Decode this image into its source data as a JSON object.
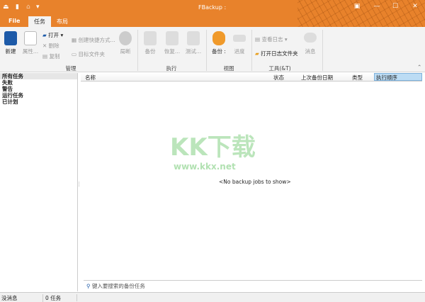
{
  "window": {
    "title": "FBackup :",
    "restore_icon": "restore-icon",
    "minimize": "—",
    "maximize": "☐",
    "close": "✕"
  },
  "tabs": [
    "File",
    "任务",
    "布局"
  ],
  "ribbon": {
    "manage": {
      "label": "管理",
      "new": "新建",
      "props": "属性...",
      "open": "打开",
      "delete": "删除",
      "copy": "复制",
      "create_shortcut": "创建快捷方式...",
      "target_folder": "目标文件夹",
      "restore": "局断"
    },
    "run": {
      "label": "执行",
      "backup": "备份",
      "restore": "恢复...",
      "test": "测试..."
    },
    "view": {
      "label": "视图",
      "backup": "备份 :",
      "progress": "进度"
    },
    "tools": {
      "label": "工具(&T)",
      "view_log": "查看日志",
      "open_log_folder": "打开日志文件夹",
      "message": "消息"
    }
  },
  "sidebar": [
    "所有任务",
    "失败",
    "警告",
    "运行任务",
    "已计划"
  ],
  "columns": [
    "名称",
    "状态",
    "上次备份日期",
    "类型",
    "执行顺序"
  ],
  "empty_text": "<No backup jobs to show>",
  "search_placeholder": "键入要搜索的备份任务",
  "status": {
    "messages": "没消息",
    "tasks": "0 任务"
  },
  "watermark": {
    "logo": "KK下载",
    "url": "www.kkx.net"
  }
}
